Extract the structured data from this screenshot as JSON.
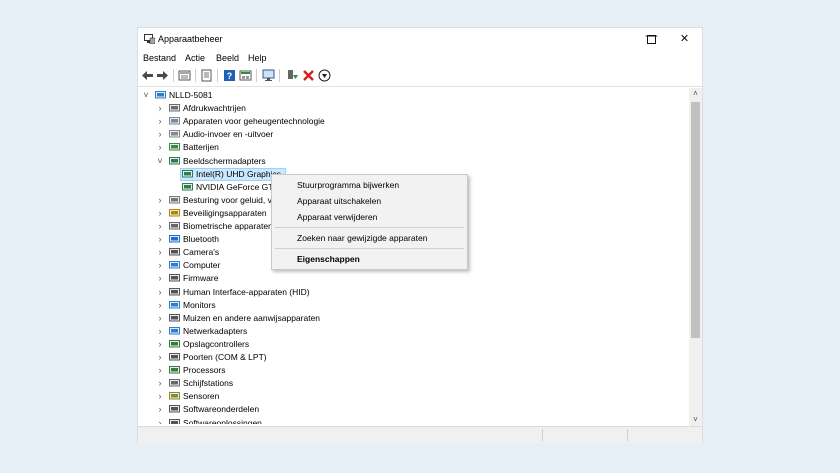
{
  "window": {
    "title": "Apparaatbeheer",
    "controls": [
      "—",
      "☐",
      "✕"
    ]
  },
  "menubar": [
    "Bestand",
    "Actie",
    "Beeld",
    "Help"
  ],
  "toolbar": {
    "icons": [
      "back-icon",
      "forward-icon",
      "properties-view-icon",
      "properties-icon",
      "help-icon",
      "details-view-icon",
      "monitor-scan-icon",
      "update-driver-icon",
      "uninstall-icon",
      "download-icon"
    ],
    "colors": {
      "blue": "#1f5fb6",
      "red": "#d0231b",
      "green": "#2e8b3d"
    }
  },
  "tree": {
    "root": "NLLD-5081",
    "items": [
      {
        "label": "Afdrukwachtrijen",
        "icon": "printer-icon",
        "expanded": false
      },
      {
        "label": "Apparaten voor geheugentechnologie",
        "icon": "memory-device-icon",
        "expanded": false
      },
      {
        "label": "Audio-invoer en -uitvoer",
        "icon": "speaker-icon",
        "expanded": false
      },
      {
        "label": "Batterijen",
        "icon": "battery-icon",
        "expanded": false
      },
      {
        "label": "Beeldschermadapters",
        "icon": "display-adapter-icon",
        "expanded": true,
        "children": [
          {
            "label": "Intel(R) UHD Graphics",
            "icon": "display-adapter-icon",
            "selected": true
          },
          {
            "label": "NVIDIA GeForce GT",
            "icon": "display-adapter-icon"
          }
        ]
      },
      {
        "label": "Besturing voor geluid, v",
        "icon": "sound-controller-icon",
        "expanded": false
      },
      {
        "label": "Beveiligingsapparaten",
        "icon": "security-device-icon",
        "expanded": false
      },
      {
        "label": "Biometrische apparaten",
        "icon": "biometric-icon",
        "expanded": false
      },
      {
        "label": "Bluetooth",
        "icon": "bluetooth-icon",
        "expanded": false
      },
      {
        "label": "Camera's",
        "icon": "camera-icon",
        "expanded": false
      },
      {
        "label": "Computer",
        "icon": "computer-icon",
        "expanded": false
      },
      {
        "label": "Firmware",
        "icon": "firmware-icon",
        "expanded": false
      },
      {
        "label": "Human Interface-apparaten (HID)",
        "icon": "hid-icon",
        "expanded": false
      },
      {
        "label": "Monitors",
        "icon": "monitor-icon",
        "expanded": false
      },
      {
        "label": "Muizen en andere aanwijsapparaten",
        "icon": "mouse-icon",
        "expanded": false
      },
      {
        "label": "Netwerkadapters",
        "icon": "network-adapter-icon",
        "expanded": false
      },
      {
        "label": "Opslagcontrollers",
        "icon": "storage-controller-icon",
        "expanded": false
      },
      {
        "label": "Poorten (COM & LPT)",
        "icon": "port-icon",
        "expanded": false
      },
      {
        "label": "Processors",
        "icon": "processor-icon",
        "expanded": false
      },
      {
        "label": "Schijfstations",
        "icon": "disk-drive-icon",
        "expanded": false
      },
      {
        "label": "Sensoren",
        "icon": "sensor-icon",
        "expanded": false
      },
      {
        "label": "Softwareonderdelen",
        "icon": "software-component-icon",
        "expanded": false
      },
      {
        "label": "Softwareoplossingen",
        "icon": "software-solution-icon",
        "expanded": false
      }
    ]
  },
  "context_menu": {
    "items": [
      {
        "label": "Stuurprogramma bijwerken",
        "bold": false
      },
      {
        "label": "Apparaat uitschakelen",
        "bold": false
      },
      {
        "label": "Apparaat verwijderen",
        "bold": false
      },
      {
        "label": "Zoeken naar gewijzigde apparaten",
        "bold": false
      },
      {
        "label": "Eigenschappen",
        "bold": true
      }
    ]
  },
  "scrollbar": {
    "up": "˄",
    "down": "˅"
  },
  "colors": {
    "selection_bg": "#cce8ff",
    "selection_border": "#99d1ff",
    "page_bg": "#e6f0f6"
  }
}
